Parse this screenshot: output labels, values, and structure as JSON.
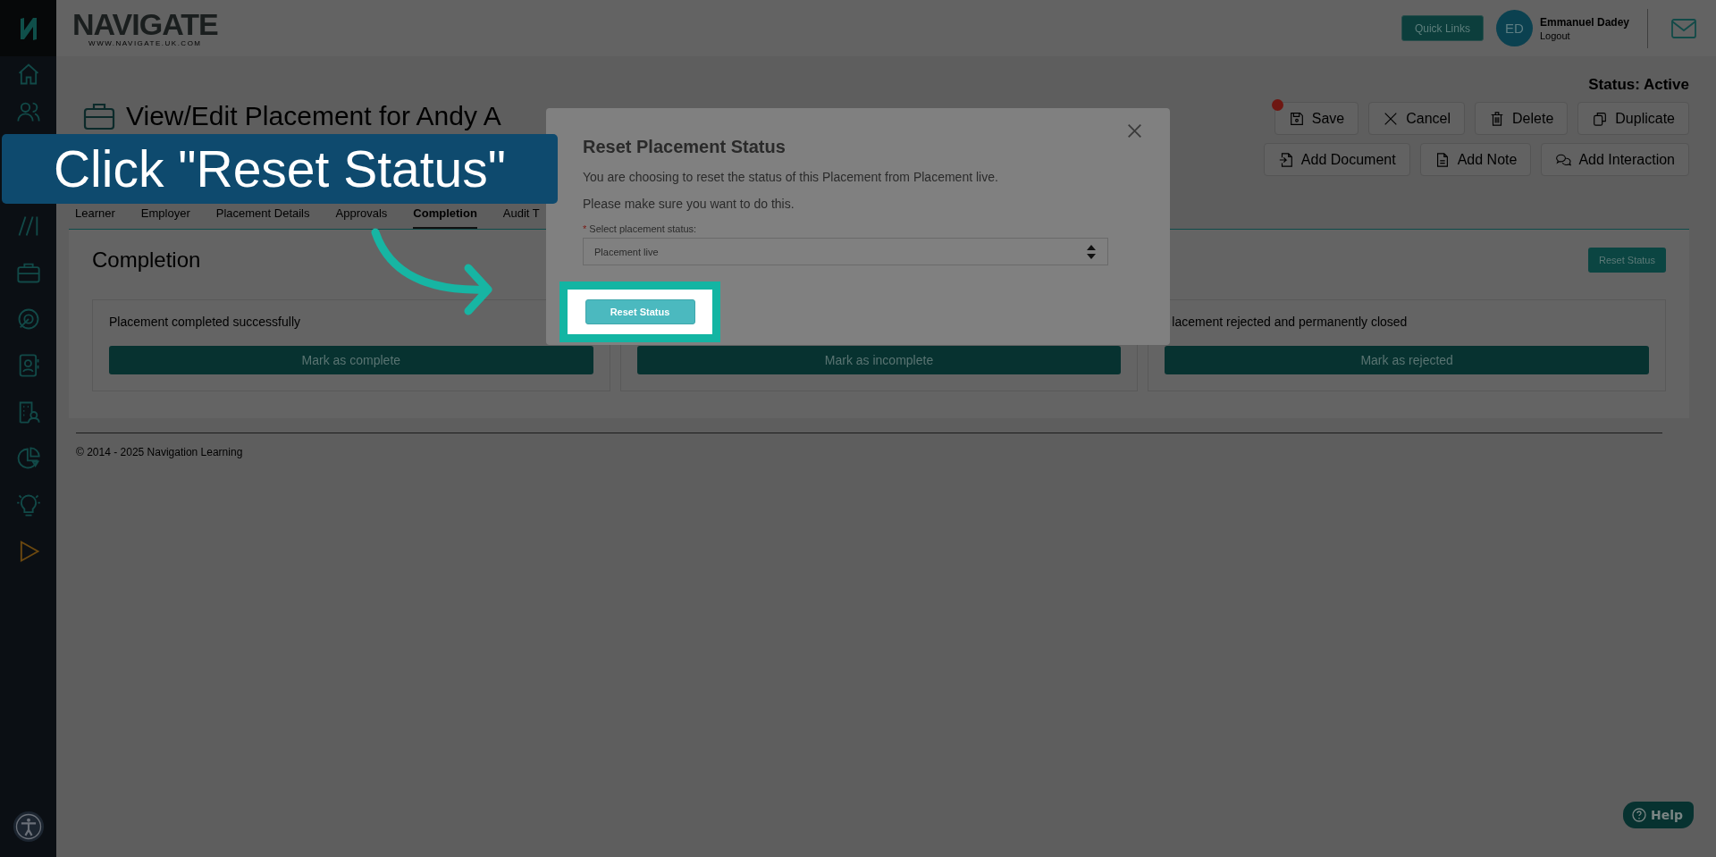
{
  "header": {
    "logo": {
      "name": "NAVIGATE",
      "tagline": "WWW.NAVIGATE.UK.COM"
    },
    "quick_links": "Quick Links",
    "user": {
      "initials": "ED",
      "name": "Emmanuel Dadey",
      "logout": "Logout"
    }
  },
  "page": {
    "title": "View/Edit Placement for Andy A",
    "status": "Status: Active",
    "actions": [
      {
        "kind": "save",
        "label": "Save",
        "notification_dot": true
      },
      {
        "kind": "cancel",
        "label": "Cancel",
        "notification_dot": false
      },
      {
        "kind": "delete",
        "label": "Delete",
        "notification_dot": false
      },
      {
        "kind": "duplicate",
        "label": "Duplicate",
        "notification_dot": false
      }
    ],
    "actions_2": [
      {
        "kind": "document",
        "label": "Add Document"
      },
      {
        "kind": "note",
        "label": "Add Note"
      },
      {
        "kind": "interaction",
        "label": "Add Interaction"
      }
    ]
  },
  "tabs": [
    {
      "label": "Learner",
      "selected": false
    },
    {
      "label": "Employer",
      "selected": false
    },
    {
      "label": "Placement Details",
      "selected": false
    },
    {
      "label": "Approvals",
      "selected": false
    },
    {
      "label": "Completion",
      "selected": true
    },
    {
      "label": "Audit T",
      "selected": false
    }
  ],
  "completion": {
    "heading": "Completion",
    "reset_button": "Reset Status",
    "cards": [
      {
        "text": "Placement completed successfully",
        "button": "Mark as complete"
      },
      {
        "button": "Mark as incomplete"
      },
      {
        "text": "lacement rejected and permanently closed",
        "button": "Mark as rejected"
      }
    ]
  },
  "footer": "© 2014 - 2025 Navigation Learning",
  "modal": {
    "title": "Reset Placement Status",
    "paragraphs": [
      "You are choosing to reset the status of this Placement from Placement live.",
      "Please make sure you want to do this."
    ],
    "field": {
      "label": "Select placement status:",
      "required_mark": "*",
      "value": "Placement live"
    },
    "button": "Reset Status"
  },
  "callout": {
    "text": "Click \"Reset Status\""
  },
  "help": "Help"
}
